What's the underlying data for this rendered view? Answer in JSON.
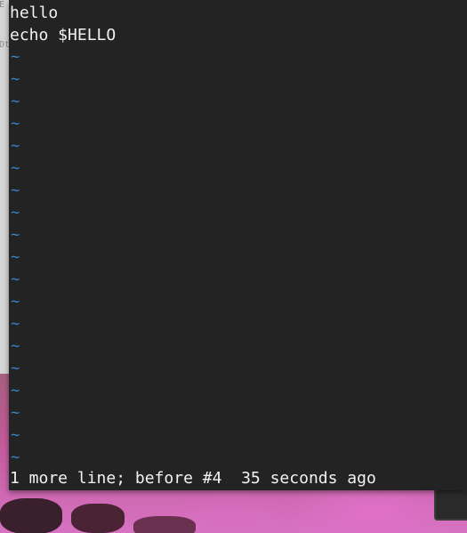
{
  "editor": {
    "lines": [
      "hello",
      "echo $HELLO"
    ],
    "empty_marker": "~",
    "status_message": "1 more line; before #4  35 seconds ago"
  },
  "colors": {
    "terminal_bg": "#232323",
    "text": "#f2f2f2",
    "tilde": "#3c82c8"
  }
}
